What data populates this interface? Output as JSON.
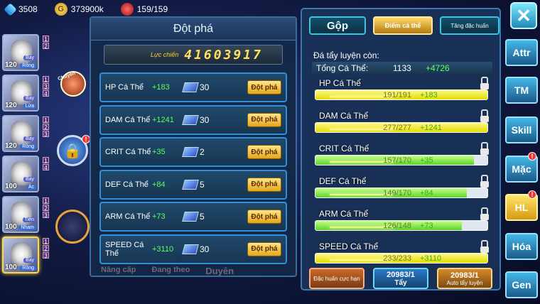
{
  "top": {
    "diamonds": "3508",
    "gold": "373900k",
    "stamina": "159/159"
  },
  "heroes": [
    {
      "level": "120",
      "tag1": "Bay",
      "tag2": "Rồng",
      "nums": [
        "1",
        "2"
      ],
      "selected": false
    },
    {
      "level": "120",
      "tag1": "Bay",
      "tag2": "Lửa",
      "nums": [
        "1",
        "3",
        "4"
      ],
      "selected": false
    },
    {
      "level": "120",
      "tag1": "Bay",
      "tag2": "Rồng",
      "nums": [
        "1",
        "2",
        "3"
      ],
      "selected": false
    },
    {
      "level": "100",
      "tag1": "Bay",
      "tag2": "Ác",
      "nums": [
        "1",
        "4"
      ],
      "selected": false
    },
    {
      "level": "100",
      "tag1": "Tiên",
      "tag2": "Nham",
      "nums": [
        "1",
        "2",
        "3"
      ],
      "selected": false
    },
    {
      "level": "100",
      "tag1": "Bay",
      "tag2": "Rồng",
      "nums": [
        "1",
        "2",
        "3"
      ],
      "selected": true
    }
  ],
  "deco": {
    "badge": "!",
    "chuyen": "Chuyên"
  },
  "breakthrough": {
    "title": "Đột phá",
    "power_label": "Lực chiến",
    "power_value": "41603917",
    "button_label": "Đột phá",
    "rows": [
      {
        "name": "HP Cá Thể",
        "plus": "+183",
        "count": "30"
      },
      {
        "name": "DAM Cá Thể",
        "plus": "+1241",
        "count": "30"
      },
      {
        "name": "CRIT Cá Thể",
        "plus": "+35",
        "count": "2"
      },
      {
        "name": "DEF Cá Thể",
        "plus": "+84",
        "count": "5"
      },
      {
        "name": "ARM Cá Thể",
        "plus": "+73",
        "count": "5"
      },
      {
        "name": "SPEED Cá Thể",
        "plus": "+3110",
        "count": "30"
      }
    ]
  },
  "bottom_nav": [
    "Nâng cấp",
    "Đang theo",
    "Duyên"
  ],
  "right": {
    "tabs": {
      "gop": "Gộp",
      "ca_the": "Điểm cá thể",
      "tang": "Tăng đặc huấn"
    },
    "remaining_label": "Đá tẩy luyện còn:",
    "total": {
      "label": "Tổng Cá Thể:",
      "value": "1133",
      "plus": "+4726"
    },
    "stats": [
      {
        "name": "HP Cá Thể",
        "cur": "191/191",
        "add": "+183",
        "fill": 100,
        "green": false
      },
      {
        "name": "DAM Cá Thể",
        "cur": "277/277",
        "add": "+1241",
        "fill": 100,
        "green": false
      },
      {
        "name": "CRIT Cá Thể",
        "cur": "157/170",
        "add": "+35",
        "fill": 92,
        "green": true
      },
      {
        "name": "DEF Cá Thể",
        "cur": "149/170",
        "add": "+84",
        "fill": 88,
        "green": true
      },
      {
        "name": "ARM Cá Thể",
        "cur": "126/148",
        "add": "+73",
        "fill": 85,
        "green": true
      },
      {
        "name": "SPEED Cá Thể",
        "cur": "233/233",
        "add": "+3110",
        "fill": 100,
        "green": false
      }
    ],
    "buttons": {
      "dac_huan": "Đặc huấn cực hạn",
      "tay_count": "20983/1",
      "tay_label": "Tẩy",
      "auto_count": "20983/1",
      "auto_label": "Auto tẩy luyện"
    }
  },
  "side_buttons": {
    "close": "✕",
    "attr": "Attr",
    "tm": "TM",
    "skill": "Skill",
    "mac": "Mặc",
    "hl": "HL",
    "hoa": "Hóa",
    "gen": "Gen",
    "badge": "!"
  }
}
